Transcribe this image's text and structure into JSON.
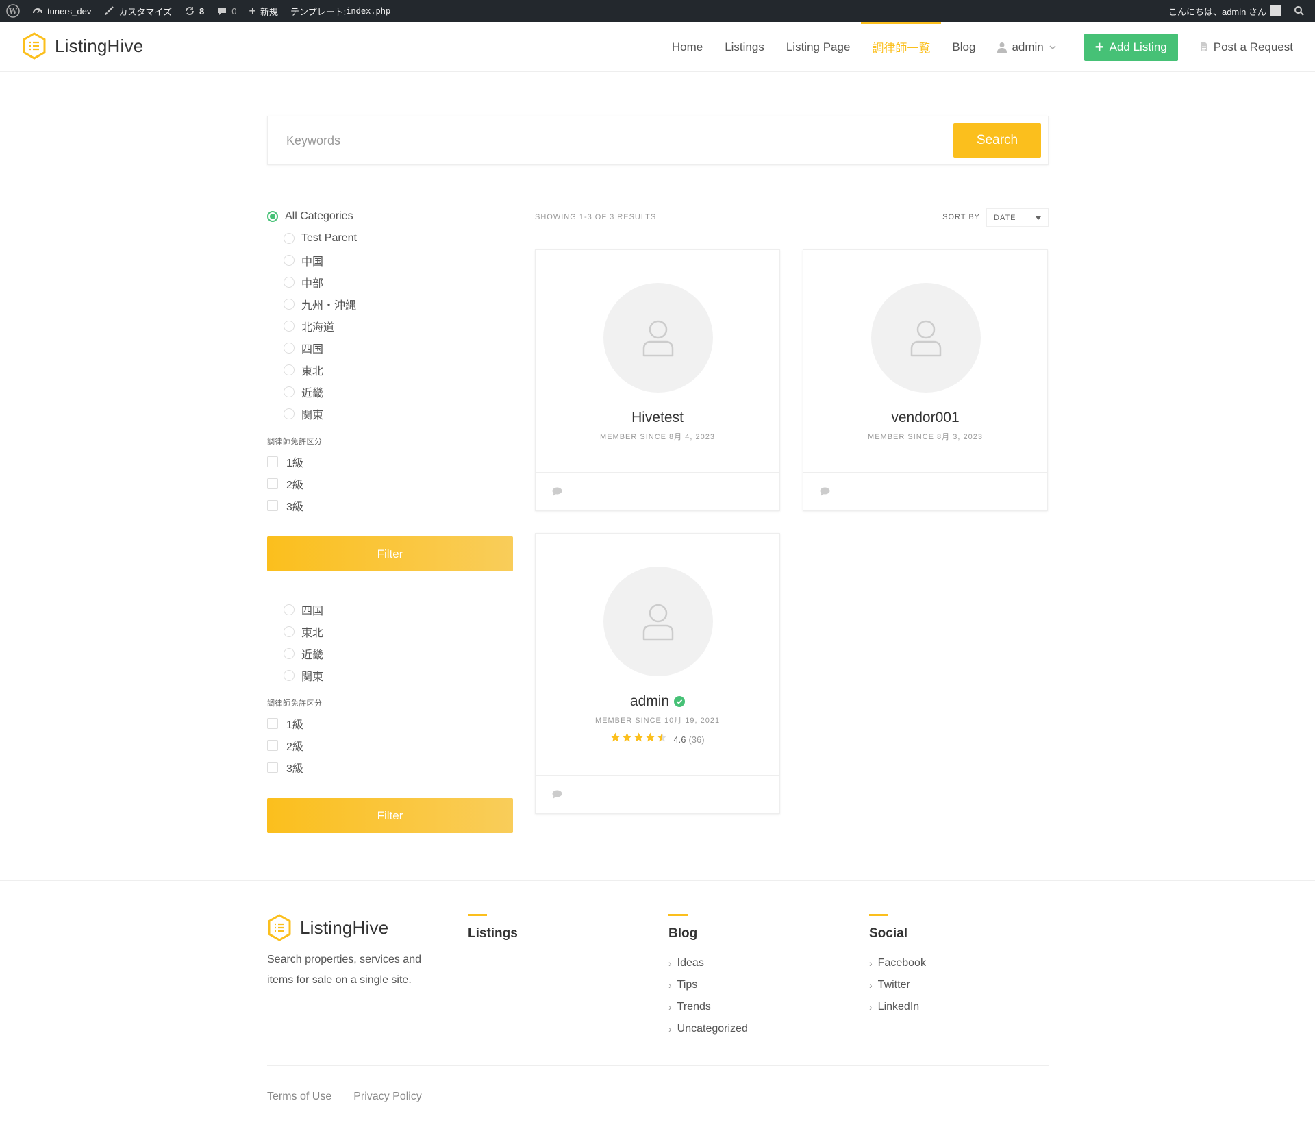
{
  "adminbar": {
    "site_name": "tuners_dev",
    "customize": "カスタマイズ",
    "updates_count": "8",
    "comments_count": "0",
    "new_label": "新規",
    "template_prefix": "テンプレート: ",
    "template_file": "index.php",
    "greeting": "こんにちは、admin さん"
  },
  "header": {
    "logo_text": "ListingHive",
    "nav": [
      "Home",
      "Listings",
      "Listing Page",
      "調律師一覧",
      "Blog"
    ],
    "user_label": "admin",
    "add_listing": "Add Listing",
    "post_request": "Post a Request"
  },
  "search": {
    "placeholder": "Keywords",
    "button": "Search"
  },
  "sidebar": {
    "groups": [
      {
        "all_label": "All Categories",
        "categories": [
          "Test Parent",
          "中国",
          "中部",
          "九州・沖縄",
          "北海道",
          "四国",
          "東北",
          "近畿",
          "関東"
        ],
        "license_title": "調律師免許区分",
        "licenses": [
          "1級",
          "2級",
          "3級"
        ],
        "filter_button": "Filter"
      },
      {
        "categories": [
          "四国",
          "東北",
          "近畿",
          "関東"
        ],
        "license_title": "調律師免許区分",
        "licenses": [
          "1級",
          "2級",
          "3級"
        ],
        "filter_button": "Filter"
      }
    ]
  },
  "results": {
    "showing": "SHOWING 1-3 OF 3 RESULTS",
    "sort_by": "SORT BY",
    "sort_value": "DATE",
    "vendors": [
      {
        "name": "Hivetest",
        "since": "MEMBER SINCE 8月 4, 2023"
      },
      {
        "name": "vendor001",
        "since": "MEMBER SINCE 8月 3, 2023"
      },
      {
        "name": "admin",
        "since": "MEMBER SINCE 10月 19, 2021",
        "verified": true,
        "rating": "4.6",
        "rating_count": "(36)",
        "stars_value": 4.5
      }
    ]
  },
  "footer": {
    "logo_text": "ListingHive",
    "description": "Search properties, services and items for sale on a single site.",
    "columns": [
      {
        "title": "Listings",
        "links": []
      },
      {
        "title": "Blog",
        "links": [
          "Ideas",
          "Tips",
          "Trends",
          "Uncategorized"
        ]
      },
      {
        "title": "Social",
        "links": [
          "Facebook",
          "Twitter",
          "LinkedIn"
        ]
      }
    ],
    "bottom_links": [
      "Terms of Use",
      "Privacy Policy"
    ]
  },
  "colors": {
    "accent": "#fbbf1d",
    "green": "#46c176",
    "adminbar_bg": "#23282d"
  }
}
